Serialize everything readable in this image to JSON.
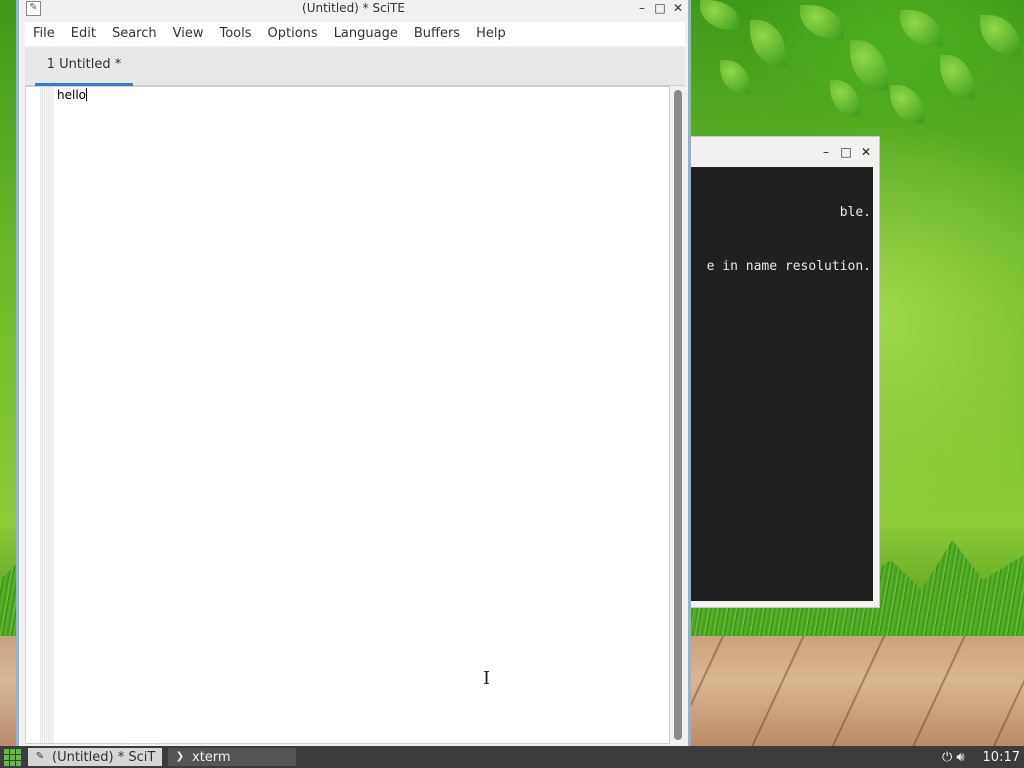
{
  "desktop": {
    "taskbar": {
      "tasks": [
        {
          "label": "(Untitled) * SciT",
          "icon": "scite-icon",
          "active": true
        },
        {
          "label": "xterm",
          "icon": "terminal-icon",
          "active": false
        }
      ],
      "clock": "10:17",
      "tray_icons": [
        "power-icon",
        "volume-icon"
      ]
    }
  },
  "xterm": {
    "lines": [
      "ble.",
      "e in name resolution."
    ]
  },
  "scite": {
    "title": "(Untitled) * SciTE",
    "window_controls": [
      "minimize-icon",
      "maximize-icon",
      "close-icon"
    ],
    "menu": [
      "File",
      "Edit",
      "Search",
      "View",
      "Tools",
      "Options",
      "Language",
      "Buffers",
      "Help"
    ],
    "tabs": [
      {
        "label": "1 Untitled *"
      }
    ],
    "editor_text": "hello"
  },
  "colors": {
    "tab_accent": "#3a7bd5",
    "window_border": "#8fb3d6",
    "taskbar": "#3c3c3c"
  }
}
